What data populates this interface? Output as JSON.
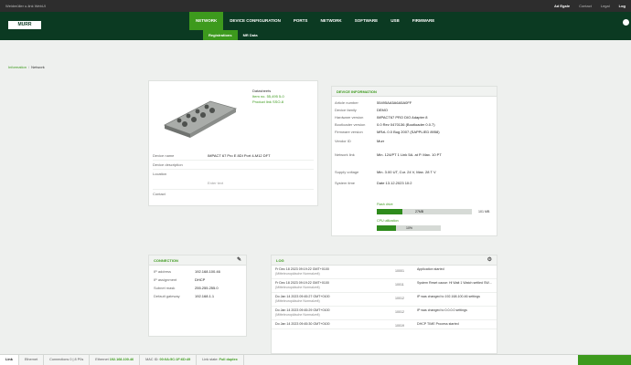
{
  "topbar": {
    "left": "Weidmüller u-link WebUI",
    "right_user": "Ad Egale",
    "right_a": "Contact",
    "right_b": "Legal",
    "right_logout": "Log"
  },
  "brand": {
    "logo_text": "MURR"
  },
  "nav": {
    "items": [
      {
        "label": "NETWORK"
      },
      {
        "label": "DEVICE CONFIGURATION"
      },
      {
        "label": "PORTS"
      },
      {
        "label": "NETWORK"
      },
      {
        "label": "SOFTWARE"
      },
      {
        "label": "USB"
      },
      {
        "label": "FIRMWARE"
      }
    ],
    "sub": [
      {
        "label": "Registrations"
      },
      {
        "label": "MR Data"
      }
    ]
  },
  "breadcrumb": {
    "root": "Information",
    "current": "Network"
  },
  "device": {
    "title": "Datasheets",
    "link1": "Item no. 55,495 5-0",
    "link2": "Product link SSO-8",
    "fields": [
      {
        "k": "Device name",
        "v": "IMPACT 67 Pro E 8DI Port 4-M12 DFT"
      },
      {
        "k": "Device description",
        "v": ""
      },
      {
        "k": "Location",
        "v": ""
      },
      {
        "k": "",
        "v": "Enter text"
      },
      {
        "k": "Contact",
        "v": ""
      }
    ]
  },
  "device_info": {
    "header": "DEVICE INFORMATION",
    "fields": [
      {
        "k": "Article number",
        "v": "55495AA5A6A5A0FF"
      },
      {
        "k": "Device family",
        "v": "DEMO"
      },
      {
        "k": "Hardware version",
        "v": "IMPACT67 PRO DIO Adapter 8"
      },
      {
        "k": "Bootloader version",
        "v": "0.0 Rev 0470136 (Bootloader 0.0.7)"
      },
      {
        "k": "Firmware version",
        "v": "MRzL 0.0 Bug 2007 (SAPPLIED 8958)"
      },
      {
        "k": "Vendor ID",
        "v": "Murr"
      },
      {
        "k": "Network link",
        "v": "Min. 124/PT 1 Link 5A. at P. Max. 10 PT"
      },
      {
        "k": "Supply voltage",
        "v": "Min. 3.00 UT, Cur. 24 V, Max. 28 T V"
      },
      {
        "k": "System time",
        "v": "Date 13.12.2023 10:2"
      }
    ],
    "storage_label": "Flash drive",
    "storage_used": "27MB",
    "storage_total": "101 MB",
    "storage_fraction": 0.27,
    "cpu_label": "CPU utilization",
    "cpu_value": "10%",
    "cpu_fraction": 0.3
  },
  "connection": {
    "header": "CONNECTION",
    "fields": [
      {
        "k": "IP address",
        "v": "192.168.100.46"
      },
      {
        "k": "IP assignment",
        "v": "DHCP"
      },
      {
        "k": "Subnet mask",
        "v": "255.255.255.0"
      },
      {
        "k": "Default gateway",
        "v": "192.168.1.1"
      }
    ]
  },
  "log": {
    "header": "LOG",
    "entries": [
      {
        "date": "Fr Dec 18 2023 09:19:22 GMT+0100",
        "src": "(Mitteleuropäische Normalzeit)",
        "code": "10001",
        "msg": "Application started"
      },
      {
        "date": "Fr Dec 18 2023 09:19:22 GMT+0100",
        "src": "(Mitteleuropäische Normalzeit)",
        "code": "10011",
        "msg": "System Reset cause: Hi Wait 1 Watch settled SW..."
      },
      {
        "date": "Do Jan 14 2023 09:45:27 GMT+0100",
        "src": "(Mitteleuropäische Normalzeit)",
        "code": "10012",
        "msg": "IP was changed to 192.168.100.46 settings"
      },
      {
        "date": "Do Jan 14 2023 09:45:29 GMT+0100",
        "src": "(Mitteleuropäische Normalzeit)",
        "code": "10012",
        "msg": "IP was changed to 0.0.0.0 settings"
      },
      {
        "date": "Do Jan 14 2023 09:45:30 GMT+0100",
        "src": "",
        "code": "10019",
        "msg": "DHCP TIME Process started"
      }
    ]
  },
  "statusbar": {
    "tabs": [
      {
        "label": "Link"
      },
      {
        "label": "Ethernet"
      },
      {
        "label": "Connections 0 | 8 P0s"
      },
      {
        "label": "Ethernet ",
        "value": "192.168.100.46"
      },
      {
        "label": "MAC ID: ",
        "value": "00:0A:5C:1F:6D:49"
      },
      {
        "label": "Link state: ",
        "value": "Full duplex"
      }
    ]
  }
}
